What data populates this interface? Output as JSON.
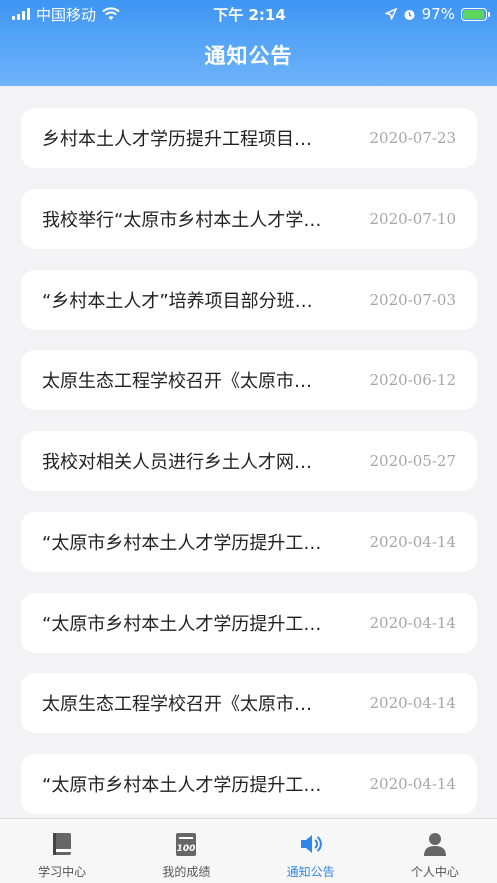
{
  "status_bar": {
    "carrier": "中国移动",
    "time": "下午 2:14",
    "battery": "97%",
    "battery_level": 0.97
  },
  "header": {
    "title": "通知公告"
  },
  "notices": [
    {
      "title": "乡村本土人才学历提升工程项目…",
      "date": "2020-07-23"
    },
    {
      "title": "我校举行“太原市乡村本土人才学…",
      "date": "2020-07-10"
    },
    {
      "title": "“乡村本土人才”培养项目部分班…",
      "date": "2020-07-03"
    },
    {
      "title": "太原生态工程学校召开《太原市…",
      "date": "2020-06-12"
    },
    {
      "title": "我校对相关人员进行乡土人才网…",
      "date": "2020-05-27"
    },
    {
      "title": "“太原市乡村本土人才学历提升工…",
      "date": "2020-04-14"
    },
    {
      "title": "“太原市乡村本土人才学历提升工…",
      "date": "2020-04-14"
    },
    {
      "title": "太原生态工程学校召开《太原市…",
      "date": "2020-04-14"
    },
    {
      "title": "“太原市乡村本土人才学历提升工…",
      "date": "2020-04-14"
    }
  ],
  "tabbar": {
    "tabs": [
      {
        "label": "学习中心",
        "icon": "book-icon",
        "active": false
      },
      {
        "label": "我的成绩",
        "icon": "score-icon",
        "active": false
      },
      {
        "label": "通知公告",
        "icon": "speaker-icon",
        "active": true
      },
      {
        "label": "个人中心",
        "icon": "person-icon",
        "active": false
      }
    ],
    "active_color": "#2f86e8",
    "inactive_color": "#555555"
  }
}
